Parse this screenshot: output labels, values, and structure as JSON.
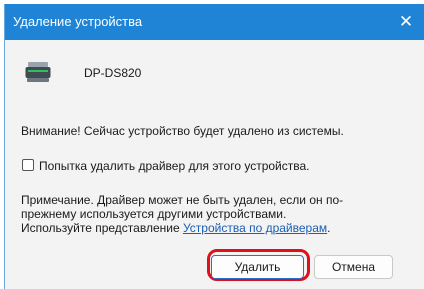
{
  "window": {
    "title": "Удаление устройства",
    "close_glyph": "✕"
  },
  "device": {
    "icon": "printer-scanner-icon",
    "name": "DP-DS820"
  },
  "warning_text": "Внимание! Сейчас устройство будет удалено из системы.",
  "checkbox": {
    "label": "Попытка удалить драйвер для этого устройства.",
    "checked": false
  },
  "note": {
    "line1": "Примечание. Драйвер может не быть удален, если он по-",
    "line2": "прежнему используется другими устройствами.",
    "line3_prefix": "Используйте представление ",
    "link_text": "Устройства по драйверам",
    "line3_suffix": "."
  },
  "buttons": {
    "delete_label": "Удалить",
    "cancel_label": "Отмена"
  },
  "colors": {
    "titlebar": "#1f84d6",
    "link": "#1a5fb4",
    "highlight": "#e0101b"
  }
}
